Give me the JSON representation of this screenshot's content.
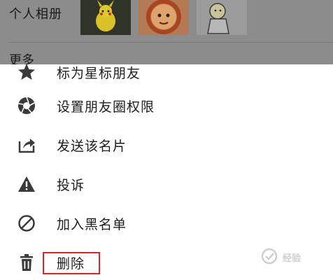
{
  "background": {
    "album_label": "个人相册",
    "more_label": "更多"
  },
  "sheet": {
    "items": [
      {
        "label": "标为星标朋友",
        "icon": "star-icon"
      },
      {
        "label": "设置朋友圈权限",
        "icon": "aperture-icon"
      },
      {
        "label": "发送该名片",
        "icon": "share-icon"
      },
      {
        "label": "投诉",
        "icon": "warning-icon"
      },
      {
        "label": "加入黑名单",
        "icon": "block-icon"
      },
      {
        "label": "删除",
        "icon": "trash-icon"
      }
    ],
    "highlighted_item": "删除",
    "highlight_color": "#d9232e"
  },
  "watermark": {
    "text": "经验"
  }
}
